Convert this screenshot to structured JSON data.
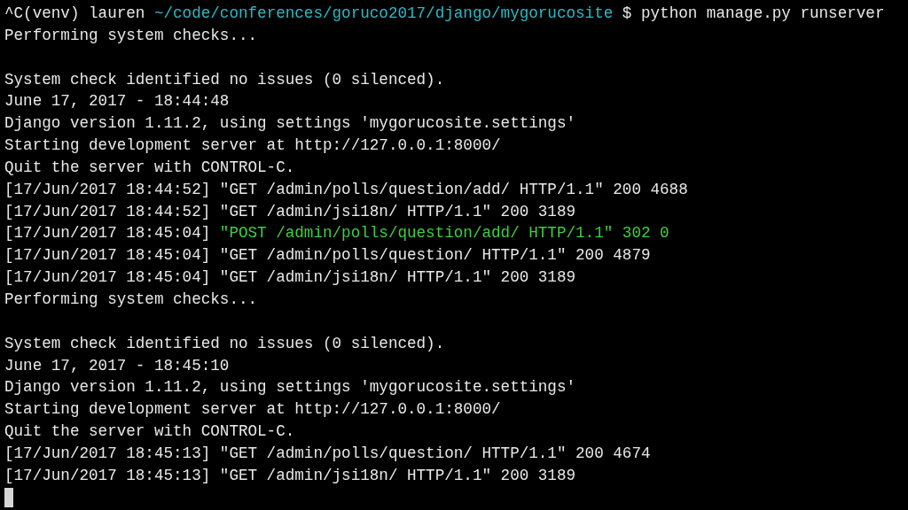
{
  "terminal": {
    "lines": [
      {
        "kind": "text",
        "segments": [
          {
            "kind": "plain",
            "text": "^C(venv) lauren "
          },
          {
            "kind": "path",
            "text": "~/code/conferences/goruco2017/django/mygorucosite"
          },
          {
            "kind": "plain",
            "text": " $ python manage.py runserver"
          }
        ]
      },
      {
        "kind": "text",
        "segments": [
          {
            "kind": "plain",
            "text": "Performing system checks..."
          }
        ]
      },
      {
        "kind": "blank"
      },
      {
        "kind": "text",
        "segments": [
          {
            "kind": "plain",
            "text": "System check identified no issues (0 silenced)."
          }
        ]
      },
      {
        "kind": "text",
        "segments": [
          {
            "kind": "plain",
            "text": "June 17, 2017 - 18:44:48"
          }
        ]
      },
      {
        "kind": "text",
        "segments": [
          {
            "kind": "plain",
            "text": "Django version 1.11.2, using settings 'mygorucosite.settings'"
          }
        ]
      },
      {
        "kind": "text",
        "segments": [
          {
            "kind": "plain",
            "text": "Starting development server at http://127.0.0.1:8000/"
          }
        ]
      },
      {
        "kind": "text",
        "segments": [
          {
            "kind": "plain",
            "text": "Quit the server with CONTROL-C."
          }
        ]
      },
      {
        "kind": "text",
        "segments": [
          {
            "kind": "plain",
            "text": "[17/Jun/2017 18:44:52] \"GET /admin/polls/question/add/ HTTP/1.1\" 200 4688"
          }
        ]
      },
      {
        "kind": "text",
        "segments": [
          {
            "kind": "plain",
            "text": "[17/Jun/2017 18:44:52] \"GET /admin/jsi18n/ HTTP/1.1\" 200 3189"
          }
        ]
      },
      {
        "kind": "text",
        "segments": [
          {
            "kind": "plain",
            "text": "[17/Jun/2017 18:45:04] "
          },
          {
            "kind": "success",
            "text": "\"POST /admin/polls/question/add/ HTTP/1.1\" 302 0"
          }
        ]
      },
      {
        "kind": "text",
        "segments": [
          {
            "kind": "plain",
            "text": "[17/Jun/2017 18:45:04] \"GET /admin/polls/question/ HTTP/1.1\" 200 4879"
          }
        ]
      },
      {
        "kind": "text",
        "segments": [
          {
            "kind": "plain",
            "text": "[17/Jun/2017 18:45:04] \"GET /admin/jsi18n/ HTTP/1.1\" 200 3189"
          }
        ]
      },
      {
        "kind": "text",
        "segments": [
          {
            "kind": "plain",
            "text": "Performing system checks..."
          }
        ]
      },
      {
        "kind": "blank"
      },
      {
        "kind": "text",
        "segments": [
          {
            "kind": "plain",
            "text": "System check identified no issues (0 silenced)."
          }
        ]
      },
      {
        "kind": "text",
        "segments": [
          {
            "kind": "plain",
            "text": "June 17, 2017 - 18:45:10"
          }
        ]
      },
      {
        "kind": "text",
        "segments": [
          {
            "kind": "plain",
            "text": "Django version 1.11.2, using settings 'mygorucosite.settings'"
          }
        ]
      },
      {
        "kind": "text",
        "segments": [
          {
            "kind": "plain",
            "text": "Starting development server at http://127.0.0.1:8000/"
          }
        ]
      },
      {
        "kind": "text",
        "segments": [
          {
            "kind": "plain",
            "text": "Quit the server with CONTROL-C."
          }
        ]
      },
      {
        "kind": "text",
        "segments": [
          {
            "kind": "plain",
            "text": "[17/Jun/2017 18:45:13] \"GET /admin/polls/question/ HTTP/1.1\" 200 4674"
          }
        ]
      },
      {
        "kind": "text",
        "segments": [
          {
            "kind": "plain",
            "text": "[17/Jun/2017 18:45:13] \"GET /admin/jsi18n/ HTTP/1.1\" 200 3189"
          }
        ]
      },
      {
        "kind": "cursor"
      }
    ]
  }
}
